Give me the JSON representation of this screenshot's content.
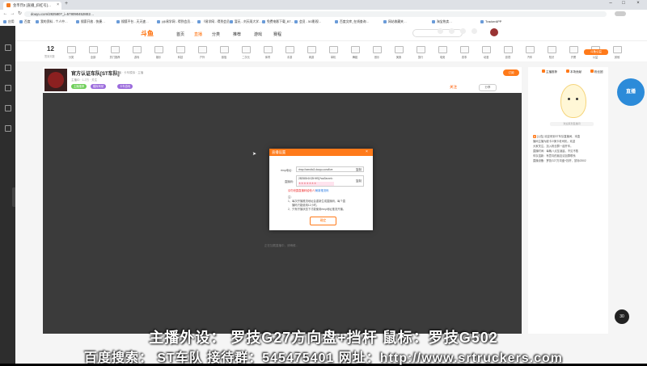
{
  "browser": {
    "tab_title": "金币罚3 [直播_斜杠号]…",
    "url": "douyu.com/282580?_i=5780904528E2…",
    "bookmarks": [
      "应用",
      "百度",
      "我的资料 - 个人中…",
      "搜索开放 - 快捷…",
      "搜狐平台 - 天天速…",
      "(@易学网 - 得到会员…",
      "《易学网 - 得到会员…",
      "暂无 - 刘天雨大学…",
      "免费电影下载_BT…",
      "会员 - 5G影视…",
      "百度文库_在线查询…",
      "网站收藏夹…",
      "淘宝热卖…",
      "TrackerAPP"
    ]
  },
  "site": {
    "logo": "斗鱼",
    "nav": [
      "首页",
      "直播",
      "分类",
      "推荐",
      "游戏",
      "赛程"
    ],
    "categories": [
      "12",
      "分类",
      "全部",
      "热门推荐",
      "游戏",
      "娱乐",
      "科技",
      "户外",
      "颜值",
      "二次元",
      "体育",
      "手游",
      "网游",
      "单机",
      "舞蹈",
      "音乐",
      "美食",
      "旅行",
      "电竞",
      "赛事",
      "动漫",
      "影视",
      "汽车",
      "知识",
      "开黑",
      "公益",
      "其他"
    ],
    "day_number": "12",
    "day_label": "签到天数",
    "promo": "斗鱼公益"
  },
  "room": {
    "title": "官方认证车队[ST车队]",
    "subtitle": "直播 · 卡车模拟 · 主播",
    "line": "主播ID · 1.2万 · 关注",
    "tags": [
      "主播推荐",
      "模拟驾驶",
      "卡车游戏"
    ],
    "follow": "关注",
    "share": "分享",
    "orange_btn": "订阅"
  },
  "player": {
    "loading": "正在加载直播中，请稍候..."
  },
  "dialog": {
    "title": "直播设置",
    "rtmp_label": "rtmp地址：",
    "rtmp_value": "rtmp://sendtc3.douyu.com/live",
    "copy1": "复制",
    "code_label": "直播码：",
    "code_value": "282580r1KZtHHSj?wsSecret=",
    "code_masked": "＊＊＊＊＊＊＊",
    "copy2": "复制",
    "warning": "请勿泄露直播码给他人！",
    "fix": "刷新推流码",
    "notes": [
      "注：",
      "1、每次开播推流地址会重新生成直播码，每个直",
      "播码只能使用12小时。",
      "2、只有开播状态下才能使用rtmp地址推流开播。"
    ],
    "ok": "确定"
  },
  "right": {
    "tabs": [
      "主播推荐",
      "本场贡献",
      "粉丝团"
    ],
    "banner": "欢迎来到直播间",
    "lines": [
      "[公告] 欢迎来到ST车队直播间，本直",
      "播间主播为欧卡2/美卡老司机，欢迎",
      "大家关注，加入粉丝群一起开车。",
      "直播时间：每晚八点至凌晨，不见不散",
      "车队招新：有意向的朋友请加群联系",
      "直播设备：罗技G27方向盘+挡杆，鼠标G502"
    ],
    "live_badge": "直播",
    "viewers": "30"
  },
  "overlay": {
    "line1": "主播外设：  罗技G27方向盘+挡杆  鼠标：罗技G502",
    "line2": "百度搜索：  ST车队  接待群：545475401  网址：http://www.srtruckers.com"
  }
}
